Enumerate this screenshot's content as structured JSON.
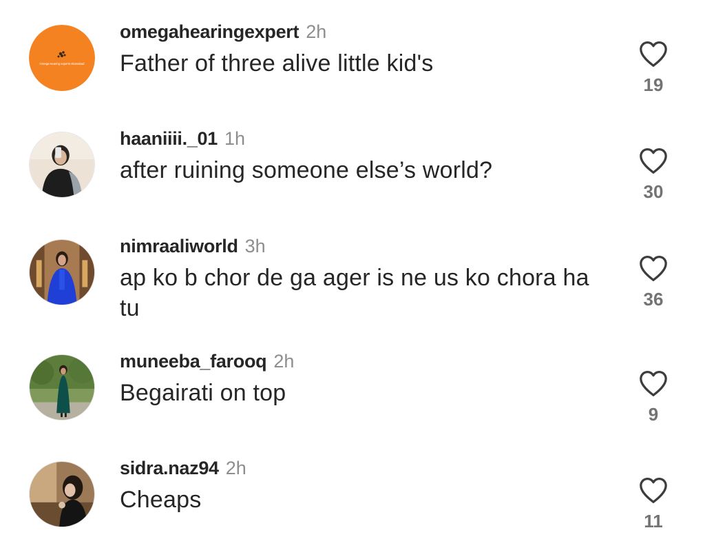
{
  "comments": [
    {
      "username": "omegahearingexpert",
      "time": "2h",
      "text": "Father of three alive little kid's",
      "likes": "19",
      "avatar_logo_text": "Omega Hearing experts Islamabad",
      "avatar_color": "#f58220"
    },
    {
      "username": "haaniiii._01",
      "time": "1h",
      "text": "after ruining someone else’s world?",
      "likes": "30",
      "avatar_color": "#e9ded0"
    },
    {
      "username": "nimraaliworld",
      "time": "3h",
      "text": "ap ko b chor de ga ager is ne us ko chora ha tu",
      "likes": "36",
      "avatar_color": "#9d6b43"
    },
    {
      "username": "muneeba_farooq",
      "time": "2h",
      "text": "Begairati on top",
      "likes": "9",
      "avatar_color": "#6f8f4a"
    },
    {
      "username": "sidra.naz94",
      "time": "2h",
      "text": "Cheaps",
      "likes": "11",
      "avatar_color": "#8a6a48"
    }
  ],
  "icons": {
    "like": "heart-outline-icon"
  },
  "colors": {
    "text": "#262626",
    "muted": "#8e8e8e",
    "count": "#737373"
  }
}
